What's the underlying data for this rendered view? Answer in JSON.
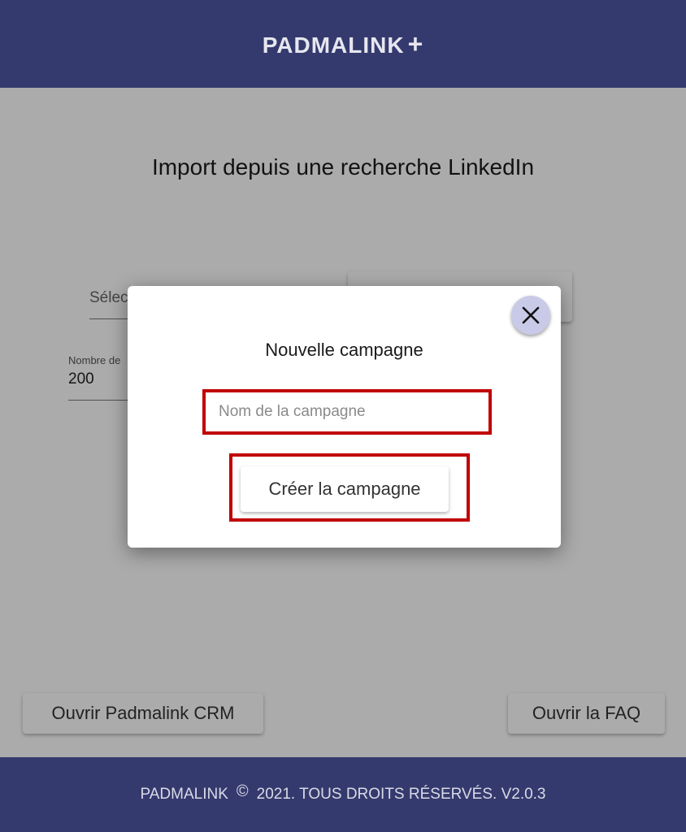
{
  "header": {
    "brand": "PADMALINK",
    "brand_plus": "+"
  },
  "main": {
    "title": "Import depuis une recherche LinkedIn",
    "select_placeholder": "Sélec",
    "number_label": "Nombre de",
    "number_value": "200",
    "footer_buttons": {
      "crm": "Ouvrir Padmalink CRM",
      "faq": "Ouvrir la FAQ"
    }
  },
  "modal": {
    "title": "Nouvelle campagne",
    "input_placeholder": "Nom de la campagne",
    "create_button": "Créer la campagne",
    "highlight_color": "#c00000",
    "close_icon": "close-icon"
  },
  "footer": {
    "brand": "PADMALINK",
    "copyright_symbol": "©",
    "text": "2021. TOUS DROITS RÉSERVÉS. V2.0.3"
  },
  "colors": {
    "header_bg": "#353a6e",
    "close_button_bg": "#c9cae8"
  }
}
